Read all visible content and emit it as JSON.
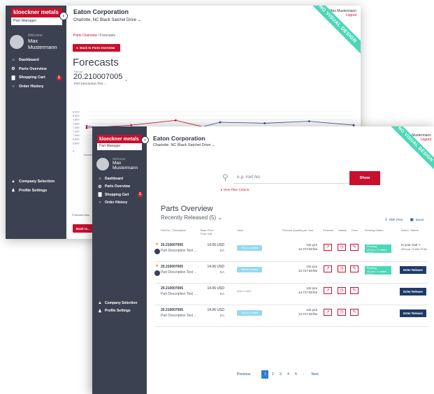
{
  "brand": {
    "name": "kloeckner metals",
    "subtitle": "Part Manager"
  },
  "user": {
    "welcome": "Welcome",
    "name": "Max Mustermann",
    "logout": "Logout"
  },
  "company": {
    "name": "Eaton Corporation",
    "location": "Charlotte, NC Black Satchel Drive"
  },
  "ribbon": "NO VISUAL DESIGN",
  "nav": [
    {
      "label": "Dashboard",
      "icon": "home-icon"
    },
    {
      "label": "Parts Overview",
      "icon": "parts-icon"
    },
    {
      "label": "Shopping Cart",
      "icon": "cart-icon",
      "badge": "1"
    },
    {
      "label": "Order History",
      "icon": "history-icon"
    }
  ],
  "nav_bottom": [
    {
      "label": "Company Selection",
      "icon": "company-icon"
    },
    {
      "label": "Profile Settings",
      "icon": "profile-icon"
    }
  ],
  "forecasts_page": {
    "breadcrumb_link": "Parts Overview",
    "breadcrumb_sep": "/",
    "breadcrumb_current": "Forecasts",
    "back_button": "Back to Parts Overview",
    "title": "Forecasts",
    "part_label": "Part No.",
    "part_no": "20.210007005",
    "part_desc": "Part Description Text ...",
    "forecast_info": "Forecast infos",
    "bottom_button": "Back to..."
  },
  "chart_data": {
    "type": "line",
    "ylim": [
      0,
      8200
    ],
    "ytick_labels": [
      "8,200",
      "8,000",
      "7,800",
      "7,600",
      "7,400",
      "7,200",
      "7,000",
      "6,800",
      "6,600",
      "...",
      "0"
    ],
    "xtick_labels": [
      "November"
    ],
    "series": [
      {
        "values": [
          5200,
          4400,
          3600,
          6000,
          5800,
          6200,
          5400
        ]
      },
      {
        "values": [
          4800,
          5400,
          6400,
          4200,
          4600,
          4500,
          5000
        ]
      }
    ],
    "colors": [
      "#2f4a86",
      "#c8102e"
    ]
  },
  "parts_page": {
    "search_placeholder": "E.g. Part No.",
    "show_button": "Show",
    "filter_link": "View Filter Criteria",
    "title": "Parts Overview",
    "subtitle": "Recently Released (5)",
    "pdf_export": "PDF Print",
    "excel_export": "Excel",
    "columns": {
      "part": "Part No. / Description",
      "price": "Base Price / Price Unit",
      "label": "Label",
      "qty": "Planned Quantity per Year",
      "forecast": "Forecast",
      "history": "History",
      "docs": "Docs",
      "pending": "Pending Orders",
      "action": "Action / Status"
    },
    "rows": [
      {
        "part_no": "20.210007005",
        "desc": "Part Description Text ...",
        "price": "14.06 USD",
        "unit": "EA",
        "label": "This is a Label",
        "label_plain": false,
        "qty": "131 pcs",
        "weight": "14,717.83 lbs",
        "pending": "Pending",
        "pending_sub": "40 pcs / 4 orders since",
        "status": "In your Cart",
        "status_detail": "325 pcs / 5,342.75 lbs",
        "action": ""
      },
      {
        "part_no": "20.210007005",
        "desc": "Part Description Text ...",
        "price": "14.06 USD",
        "unit": "EA",
        "label": "This is a Label",
        "label_plain": false,
        "qty": "131 pcs",
        "weight": "14,717.83 lbs",
        "pending": "Pending",
        "pending_sub": "40 pcs / 4 orders since",
        "status": "",
        "status_detail": "",
        "action": "Enter Release"
      },
      {
        "part_no": "20.210007005",
        "desc": "Part Description Text ...",
        "price": "14.06 USD",
        "unit": "EA",
        "label": "Add a Label",
        "label_plain": true,
        "qty": "131 pcs",
        "weight": "14,717.83 lbs",
        "pending": "",
        "pending_sub": "",
        "status": "",
        "status_detail": "",
        "action": "Enter Release"
      },
      {
        "part_no": "20.210007005",
        "desc": "Part Description Text ...",
        "price": "14.06 USD",
        "unit": "EA",
        "label": "This is a Label",
        "label_plain": false,
        "qty": "131 pcs",
        "weight": "14,717.83 lbs",
        "pending": "",
        "pending_sub": "",
        "status": "",
        "status_detail": "",
        "action": "Enter Release"
      }
    ],
    "pagination": {
      "previous": "Previous",
      "pages": [
        "1",
        "2",
        "3",
        "4",
        "5"
      ],
      "active": "1",
      "next": "Next"
    }
  }
}
